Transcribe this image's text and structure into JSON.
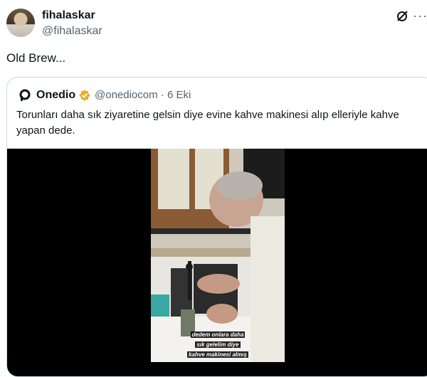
{
  "tweet": {
    "author_name": "fihalaskar",
    "author_handle": "@fihalaskar",
    "text": "Old Brew...",
    "icons": [
      "grok-icon",
      "more-icon"
    ]
  },
  "quote": {
    "author_name": "Onedio",
    "author_handle": "@onediocom",
    "separator": "·",
    "date": "6 Eki",
    "text": "Torunları daha sık ziyaretine gelsin diye evine kahve makinesi alıp elleriyle kahve yapan dede.",
    "verified_color": "#e8b12a",
    "video_caption": [
      "dedem onlara daha",
      "sık gelelim diye",
      "kahve makinesi almış"
    ]
  },
  "more_label": "···"
}
